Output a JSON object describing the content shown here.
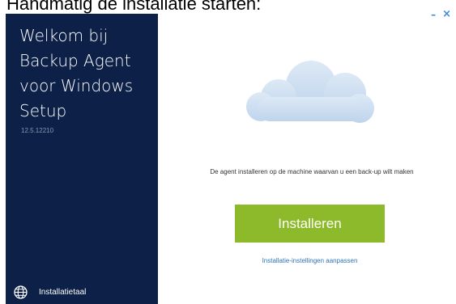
{
  "caption": "Handmatig de installatie starten:",
  "sidebar": {
    "title": "Welkom bij\nBackup Agent\nvoor Windows\nSetup",
    "version": "12.5.12210",
    "language_label": "Installatietaal",
    "language_icon": "globe-icon",
    "background_color": "#0c2048"
  },
  "window_controls": {
    "minimize": "–",
    "close": "×"
  },
  "main": {
    "illustration": "cloud-icon",
    "description": "De agent installeren op de machine waarvan u een back-up wilt maken",
    "install_label": "Installeren",
    "install_color": "#8dba2a",
    "settings_link": "Installatie-instellingen aanpassen"
  }
}
